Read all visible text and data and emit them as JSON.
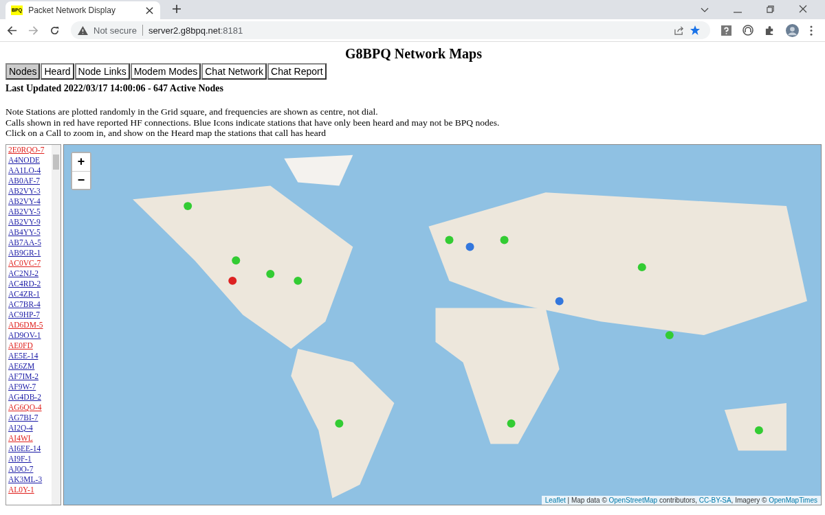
{
  "browser": {
    "tab_title": "Packet Network Display",
    "favicon": "BPQ",
    "url_host": "server2.g8bpq.net",
    "url_port": ":8181",
    "security": "Not secure"
  },
  "page": {
    "title": "G8BPQ Network Maps",
    "tabs": [
      {
        "label": "Nodes",
        "selected": true
      },
      {
        "label": "Heard",
        "selected": false
      },
      {
        "label": "Node Links",
        "selected": false
      },
      {
        "label": "Modem Modes",
        "selected": false
      },
      {
        "label": "Chat Network",
        "selected": false
      },
      {
        "label": "Chat Report",
        "selected": false
      }
    ],
    "last_updated": "Last Updated 2022/03/17 14:00:06 - 647 Active Nodes",
    "notes": [
      "Note Stations are plotted randomly in the Grid square, and frequencies are shown as centre, not dial.",
      "Calls shown in red have reported HF connections. Blue Icons indicate stations that have only been heard and may not be BPQ nodes.",
      "Click on a Call to zoom in, and show on the Heard map the stations that call has heard"
    ],
    "calls": [
      {
        "call": "2E0RQO-7",
        "hf": true
      },
      {
        "call": "A4NODE",
        "hf": false
      },
      {
        "call": "AA1LO-4",
        "hf": false
      },
      {
        "call": "AB0AF-7",
        "hf": false
      },
      {
        "call": "AB2VY-3",
        "hf": false
      },
      {
        "call": "AB2VY-4",
        "hf": false
      },
      {
        "call": "AB2VY-5",
        "hf": false
      },
      {
        "call": "AB2VY-9",
        "hf": false
      },
      {
        "call": "AB4YY-5",
        "hf": false
      },
      {
        "call": "AB7AA-5",
        "hf": false
      },
      {
        "call": "AB9GR-1",
        "hf": false
      },
      {
        "call": "AC0VC-7",
        "hf": true
      },
      {
        "call": "AC2NJ-2",
        "hf": false
      },
      {
        "call": "AC4RD-2",
        "hf": false
      },
      {
        "call": "AC4ZR-1",
        "hf": false
      },
      {
        "call": "AC7BR-4",
        "hf": false
      },
      {
        "call": "AC9HP-7",
        "hf": false
      },
      {
        "call": "AD6DM-5",
        "hf": true
      },
      {
        "call": "AD9OV-1",
        "hf": false
      },
      {
        "call": "AE0FD",
        "hf": true
      },
      {
        "call": "AE5E-14",
        "hf": false
      },
      {
        "call": "AE6ZM",
        "hf": false
      },
      {
        "call": "AF7IM-2",
        "hf": false
      },
      {
        "call": "AF9W-7",
        "hf": false
      },
      {
        "call": "AG4DB-2",
        "hf": false
      },
      {
        "call": "AG6QO-4",
        "hf": true
      },
      {
        "call": "AG7BI-7",
        "hf": false
      },
      {
        "call": "AI2Q-4",
        "hf": false
      },
      {
        "call": "AI4WL",
        "hf": true
      },
      {
        "call": "AI6EE-14",
        "hf": false
      },
      {
        "call": "AI9F-1",
        "hf": false
      },
      {
        "call": "AJ0O-7",
        "hf": false
      },
      {
        "call": "AK3ML-3",
        "hf": false
      },
      {
        "call": "AL0Y-1",
        "hf": true
      }
    ],
    "map": {
      "zoom_in": "+",
      "zoom_out": "−",
      "attribution": [
        {
          "text": "Leaflet",
          "link": true
        },
        {
          "text": " | Map data © ",
          "link": false
        },
        {
          "text": "OpenStreetMap",
          "link": true
        },
        {
          "text": " contributors, ",
          "link": false
        },
        {
          "text": "CC-BY-SA",
          "link": true
        },
        {
          "text": ", Imagery © ",
          "link": false
        },
        {
          "text": "OpenMapTimes",
          "link": true
        }
      ]
    }
  }
}
